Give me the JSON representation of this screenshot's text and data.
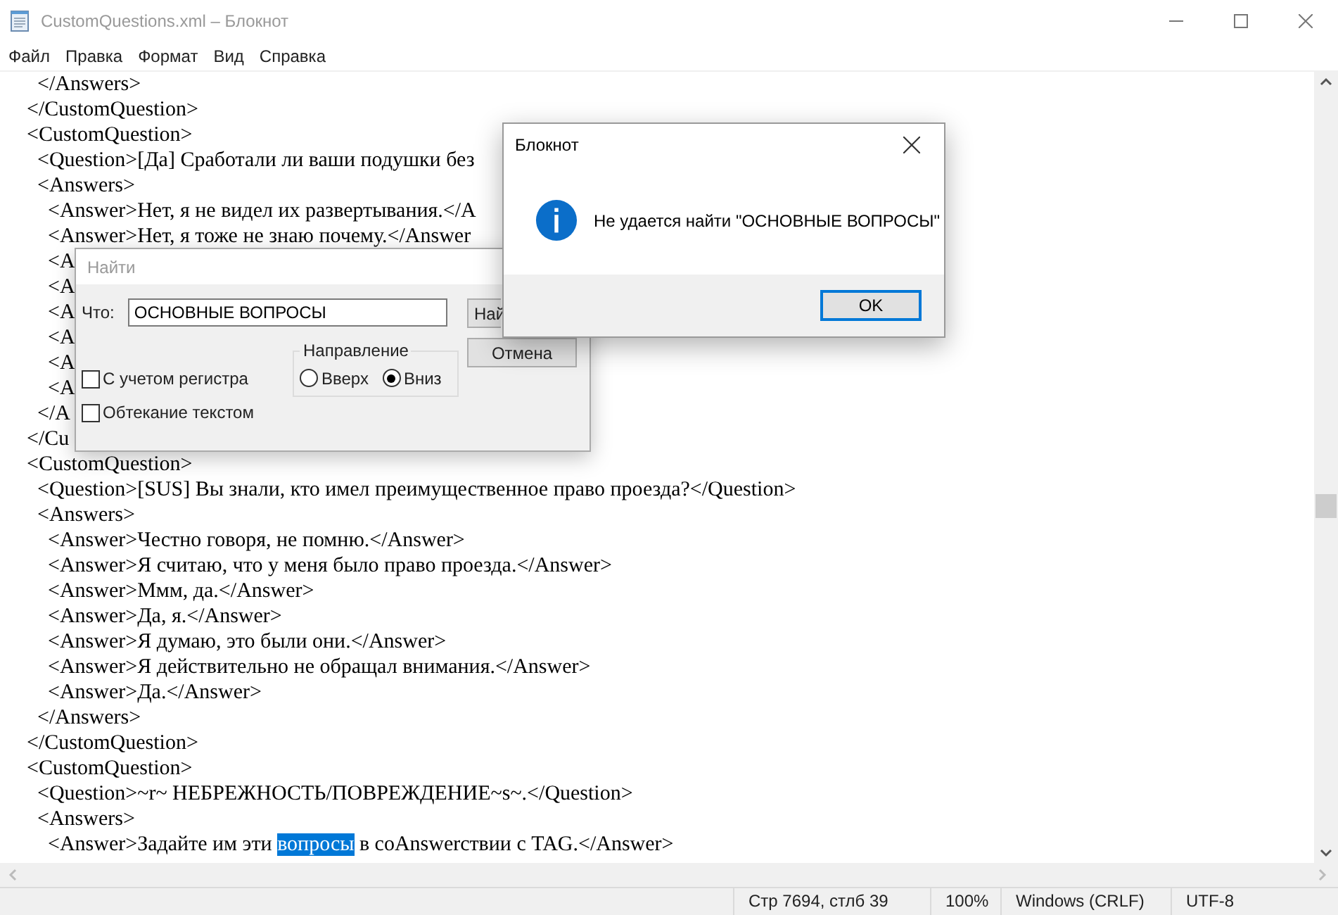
{
  "window": {
    "title": "CustomQuestions.xml – Блокнот"
  },
  "menu": [
    "Файл",
    "Правка",
    "Формат",
    "Вид",
    "Справка"
  ],
  "editor": {
    "lines": [
      {
        "text": "      </Answers>"
      },
      {
        "text": "    </CustomQuestion>"
      },
      {
        "text": "    <CustomQuestion>"
      },
      {
        "text": "      <Question>[Да] Сработали ли ваши подушки без"
      },
      {
        "text": "      <Answers>"
      },
      {
        "text": "        <Answer>Нет, я не видел их развертывания.</A"
      },
      {
        "text": "        <Answer>Нет, я тоже не знаю почему.</Answer"
      },
      {
        "text": "        <A"
      },
      {
        "text": "        <A"
      },
      {
        "text": "        <A"
      },
      {
        "text": "        <A"
      },
      {
        "text": "        <A"
      },
      {
        "text": "        <A"
      },
      {
        "text": "      </A"
      },
      {
        "text": "    </Cu"
      },
      {
        "text": "    <CustomQuestion>"
      },
      {
        "text": "      <Question>[SUS] Вы знали, кто имел преимущественное право проезда?</Question>"
      },
      {
        "text": "      <Answers>"
      },
      {
        "text": "        <Answer>Честно говоря, не помню.</Answer>"
      },
      {
        "text": "        <Answer>Я считаю, что у меня было право проезда.</Answer>"
      },
      {
        "text": "        <Answer>Ммм, да.</Answer>"
      },
      {
        "text": "        <Answer>Да, я.</Answer>"
      },
      {
        "text": "        <Answer>Я думаю, это были они.</Answer>"
      },
      {
        "text": "        <Answer>Я действительно не обращал внимания.</Answer>"
      },
      {
        "text": "        <Answer>Да.</Answer>"
      },
      {
        "text": "      </Answers>"
      },
      {
        "text": "    </CustomQuestion>"
      },
      {
        "text": "    <CustomQuestion>"
      },
      {
        "text": "      <Question>~r~ НЕБРЕЖНОСТЬ/ПОВРЕЖДЕНИЕ~s~.</Question>"
      },
      {
        "text": "      <Answers>"
      },
      {
        "segments": [
          {
            "text": "        <Answer>Задайте им эти ",
            "selected": false
          },
          {
            "text": "вопросы",
            "selected": true
          },
          {
            "text": " в coAnswerствии с TAG.</Answer>",
            "selected": false
          }
        ]
      }
    ]
  },
  "status_bar": {
    "position": "Стр 7694, стлб 39",
    "zoom": "100%",
    "line_endings": "Windows (CRLF)",
    "encoding": "UTF-8"
  },
  "find_dialog": {
    "title": "Найти",
    "what_label": "Что:",
    "what_value": "ОСНОВНЫЕ ВОПРОСЫ",
    "find_button": "Най",
    "cancel_button": "Отмена",
    "direction": {
      "label": "Направление",
      "options": [
        {
          "label": "Вверх",
          "selected": false
        },
        {
          "label": "Вниз",
          "selected": true
        }
      ]
    },
    "options": [
      {
        "label": "С учетом регистра",
        "checked": false
      },
      {
        "label": "Обтекание текстом",
        "checked": false
      }
    ]
  },
  "message_box": {
    "title": "Блокнот",
    "message": "Не удается найти \"ОСНОВНЫЕ ВОПРОСЫ\"",
    "button": "OK"
  }
}
